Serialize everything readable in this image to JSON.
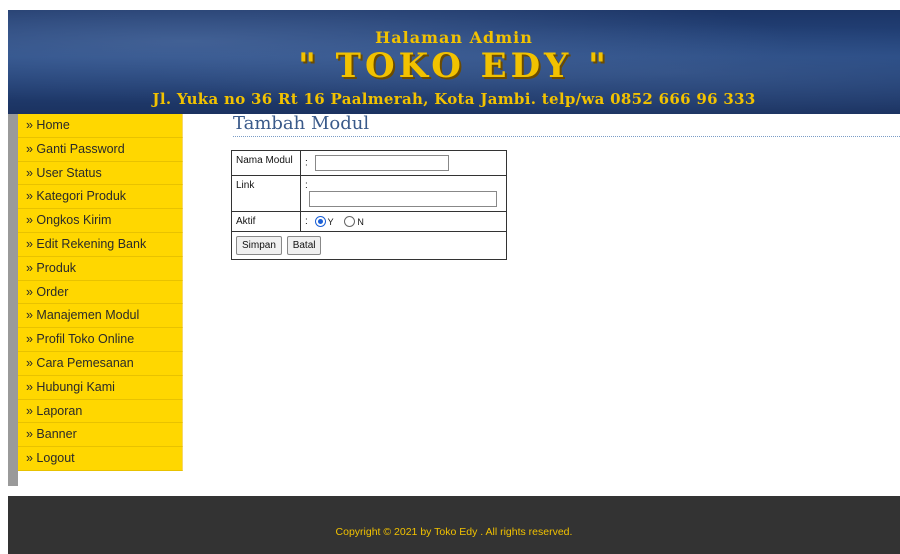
{
  "header": {
    "subtitle": "Halaman Admin",
    "title": "\" TOKO EDY \"",
    "address": "Jl. Yuka no 36 Rt 16 Paalmerah, Kota Jambi. telp/wa 0852 666 96 333"
  },
  "sidebar": {
    "items": [
      {
        "label": "» Home"
      },
      {
        "label": "» Ganti Password"
      },
      {
        "label": "» User Status"
      },
      {
        "label": "» Kategori Produk"
      },
      {
        "label": "» Ongkos Kirim"
      },
      {
        "label": "» Edit Rekening Bank"
      },
      {
        "label": "» Produk"
      },
      {
        "label": "» Order"
      },
      {
        "label": "» Manajemen Modul"
      },
      {
        "label": "» Profil Toko Online"
      },
      {
        "label": "» Cara Pemesanan"
      },
      {
        "label": "» Hubungi Kami"
      },
      {
        "label": "» Laporan"
      },
      {
        "label": "» Banner"
      },
      {
        "label": "» Logout"
      }
    ]
  },
  "main": {
    "title": "Tambah Modul",
    "form": {
      "nama_modul_label": "Nama Modul",
      "nama_modul_value": "",
      "link_label": "Link",
      "link_value": "",
      "aktif_label": "Aktif",
      "colon": ":",
      "aktif_options": [
        "Y",
        "N"
      ],
      "aktif_selected": "Y",
      "save_label": "Simpan",
      "cancel_label": "Batal"
    }
  },
  "footer": {
    "copyright": "Copyright © 2021 by Toko Edy . All rights reserved."
  },
  "colors": {
    "menu_bg": "#ffd700",
    "banner_text": "#f2c200",
    "footer_bg": "#333333"
  }
}
